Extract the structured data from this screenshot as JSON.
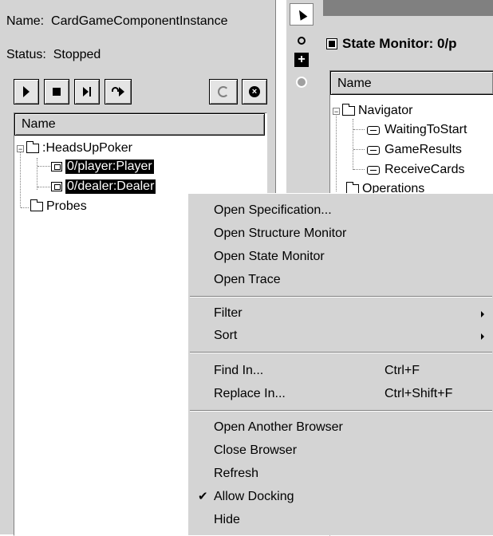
{
  "component": {
    "name_label": "Name:",
    "name_value": "CardGameComponentInstance",
    "status_label": "Status:",
    "status_value": "Stopped"
  },
  "tree": {
    "column_header": "Name",
    "items": [
      {
        "label": ":HeadsUpPoker",
        "icon": "folder-icon"
      },
      {
        "label": "0/player:Player",
        "icon": "capsule-part-icon"
      },
      {
        "label": "0/dealer:Dealer",
        "icon": "capsule-part-icon"
      },
      {
        "label": "Probes",
        "icon": "folder-icon"
      }
    ]
  },
  "state_monitor": {
    "title": "State Monitor: 0/p",
    "column_header": "Name",
    "items": [
      {
        "label": "Navigator",
        "icon": "folder-icon"
      },
      {
        "label": "WaitingToStart",
        "icon": "state-icon"
      },
      {
        "label": "GameResults",
        "icon": "state-icon"
      },
      {
        "label": "ReceiveCards",
        "icon": "state-icon"
      },
      {
        "label": "Operations",
        "icon": "folder-icon"
      }
    ]
  },
  "context_menu": {
    "items": [
      {
        "label": "Open Specification..."
      },
      {
        "label": "Open Structure Monitor"
      },
      {
        "label": "Open State Monitor"
      },
      {
        "label": "Open Trace"
      },
      {
        "label": "Filter",
        "submenu": true
      },
      {
        "label": "Sort",
        "submenu": true
      },
      {
        "label": "Find In...",
        "shortcut": "Ctrl+F"
      },
      {
        "label": "Replace In...",
        "shortcut": "Ctrl+Shift+F"
      },
      {
        "label": "Open Another Browser"
      },
      {
        "label": "Close Browser"
      },
      {
        "label": "Refresh"
      },
      {
        "label": "Allow Docking",
        "checked": true
      },
      {
        "label": "Hide"
      }
    ]
  },
  "colors": {
    "panel": "#d4d4d4",
    "selection": "#000000",
    "window_title": "#808080"
  }
}
